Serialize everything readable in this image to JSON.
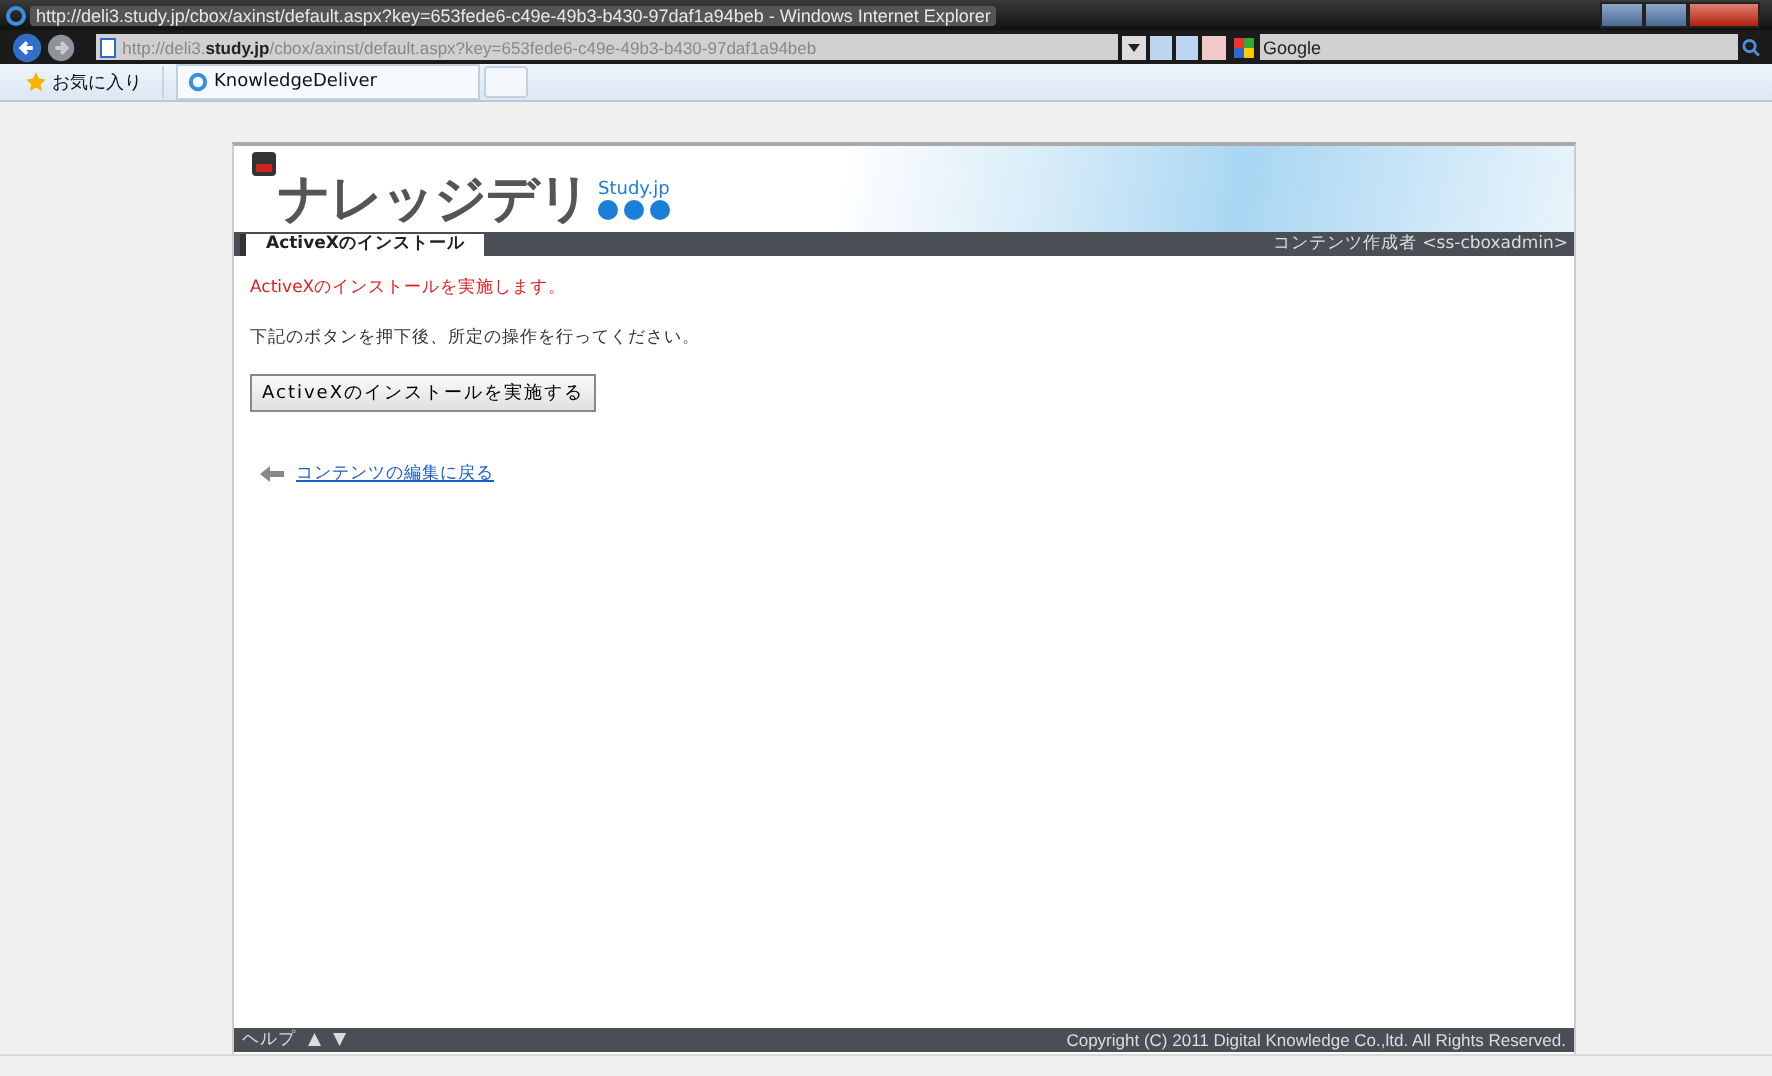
{
  "browser": {
    "title": "http://deli3.study.jp/cbox/axinst/default.aspx?key=653fede6-c49e-49b3-b430-97daf1a94beb - Windows Internet Explorer",
    "address": "http://deli3.**study.jp**/cbox/axinst/default.aspx?key=653fede6-c49e-49b3-b430-97daf1a94beb",
    "search_placeholder": "Google",
    "favorites": "お気に入り",
    "tab": "KnowledgeDeliver"
  },
  "page": {
    "logo": "ナレッジデリ",
    "logo_sub": "Study.jp",
    "tabs": [
      {
        "label": "ActiveXのインストール",
        "selected": true
      }
    ],
    "user": "コンテンツ作成者 <ss-cboxadmin>",
    "notice": "ActiveXのインストールを実施します。",
    "instruction": "下記のボタンを押下後、所定の操作を行ってください。",
    "button": "ActiveXのインストールを実施する",
    "back_link": "コンテンツの編集に戻る",
    "footer": {
      "help": "ヘルプ",
      "up": "▲",
      "down": "▼",
      "copyright": "Copyright (C) 2011 Digital Knowledge Co.,ltd. All Rights Reserved."
    }
  }
}
